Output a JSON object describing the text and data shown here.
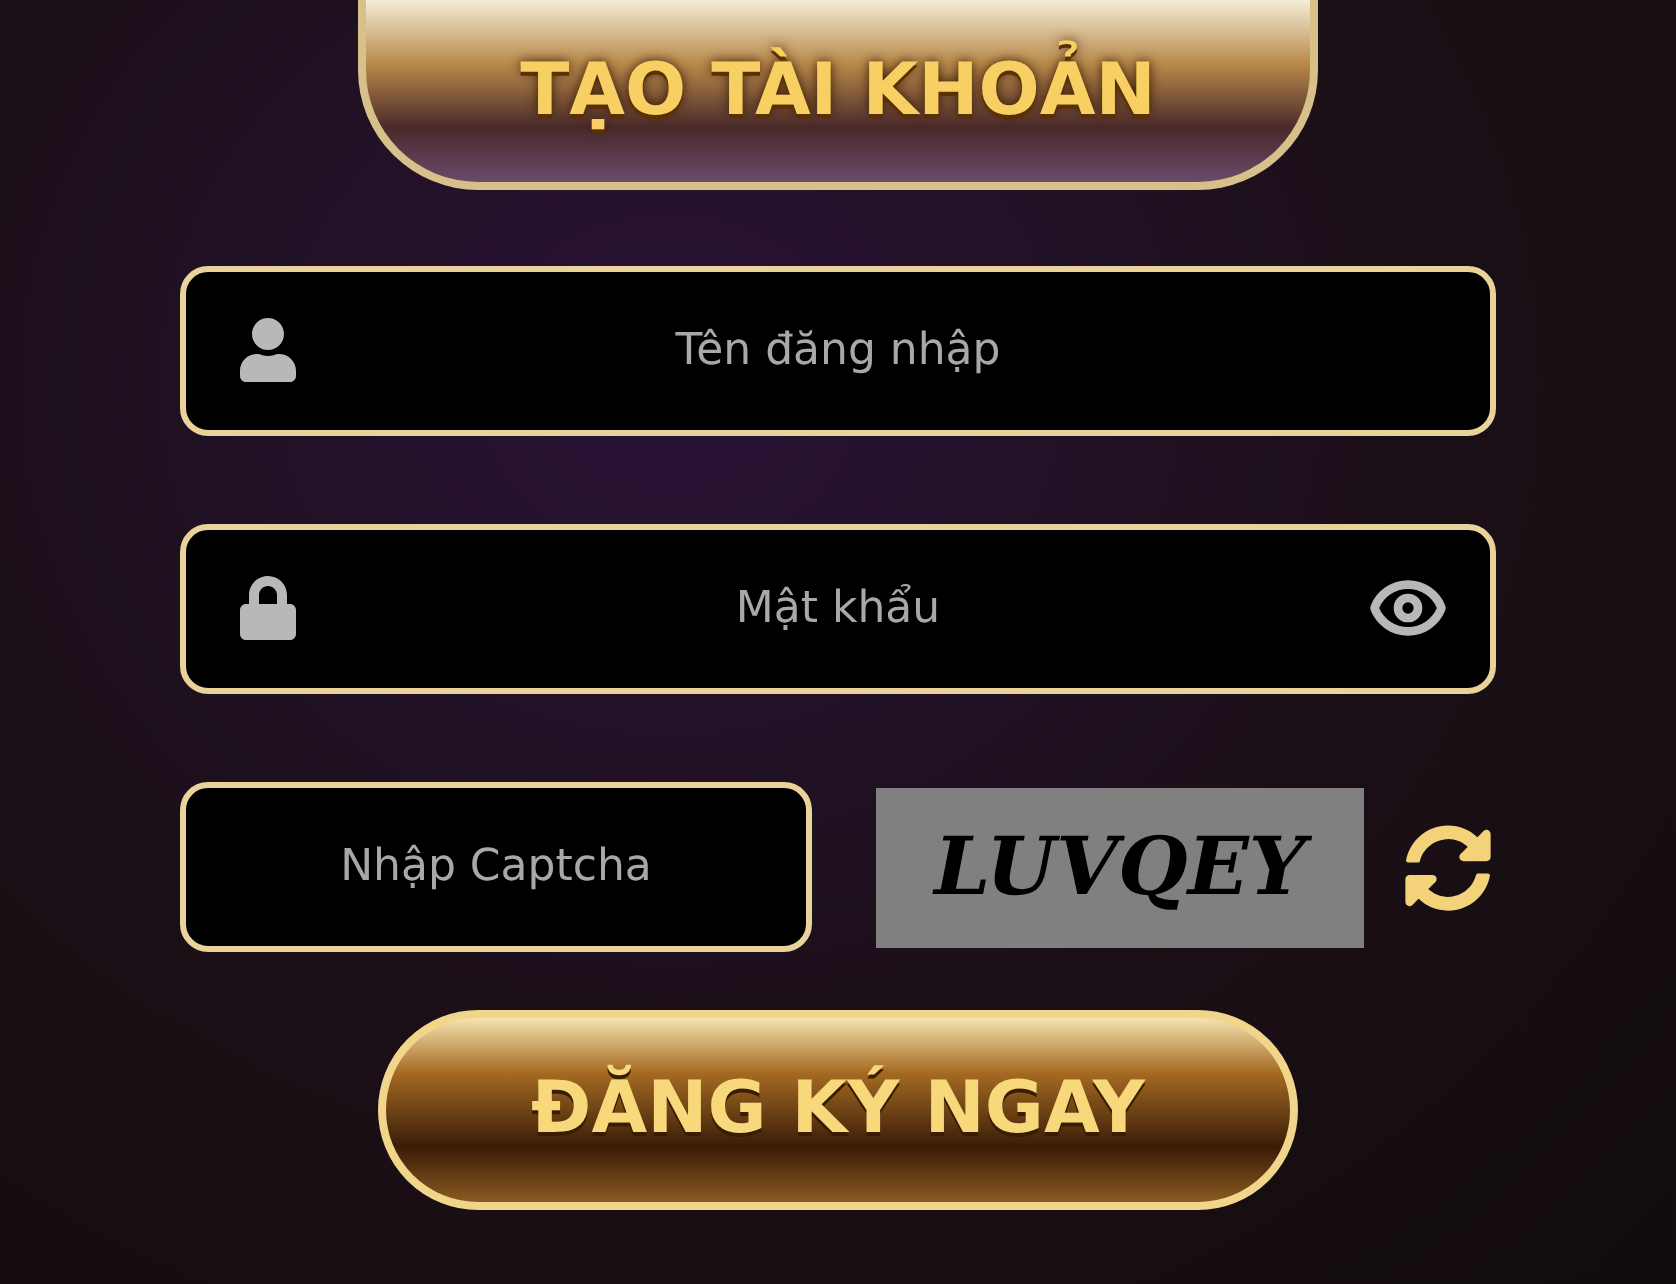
{
  "title": "TẠO TÀI KHOẢN",
  "fields": [
    {
      "kind": "user",
      "placeholder": "Tên đăng nhập"
    },
    {
      "kind": "password",
      "placeholder": "Mật khẩu"
    }
  ],
  "captcha": {
    "placeholder": "Nhập Captcha",
    "code": "LUVQEY"
  },
  "submit": "ĐĂNG KÝ NGAY"
}
